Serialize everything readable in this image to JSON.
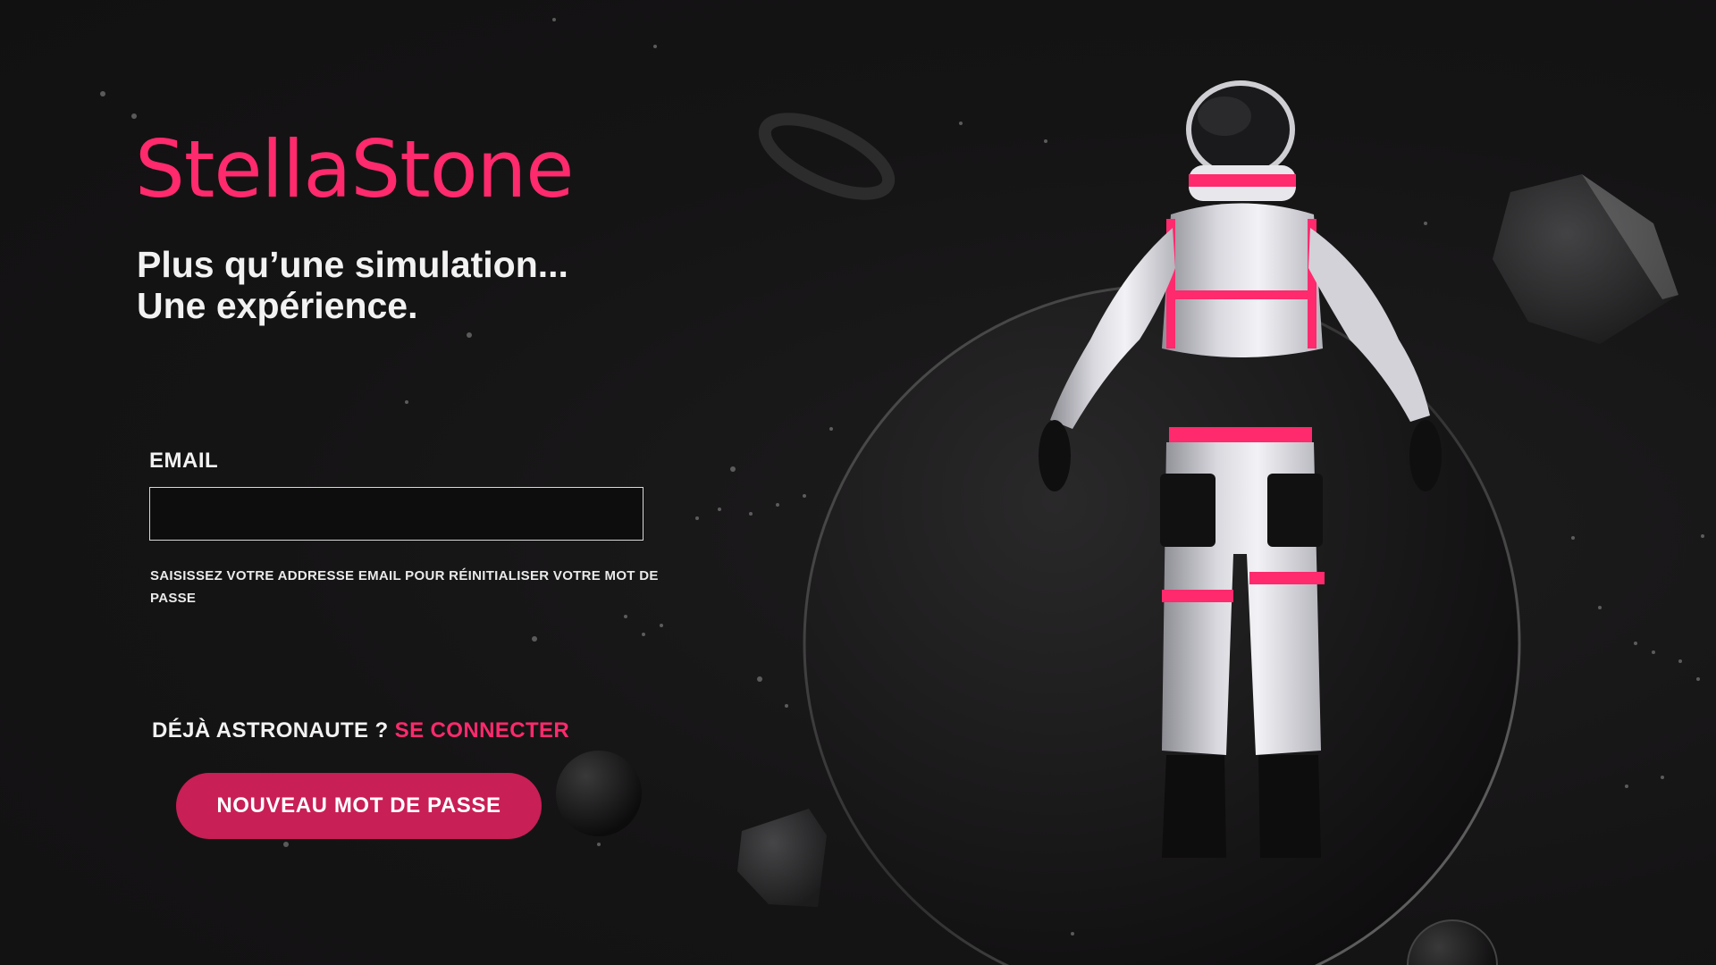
{
  "brand": {
    "name": "StellaStone",
    "color": "#ff2a6d"
  },
  "tagline": {
    "line1": "Plus qu’une simulation...",
    "line2": "Une expérience."
  },
  "form": {
    "email_label": "EMAIL",
    "email_value": "",
    "email_placeholder": "",
    "helper_text": "SAISISSEZ VOTRE ADDRESSE EMAIL POUR RÉINITIALISER VOTRE MOT DE PASSE",
    "login_prompt": "DÉJÀ ASTRONAUTE ?",
    "login_link": "SE CONNECTER",
    "submit_label": "NOUVEAU MOT DE PASSE"
  },
  "scene": {
    "illustration": "astronaut-floating-in-space",
    "accent_color": "#ff2a6d",
    "button_color": "#c81f56",
    "background_color": "#141314"
  }
}
